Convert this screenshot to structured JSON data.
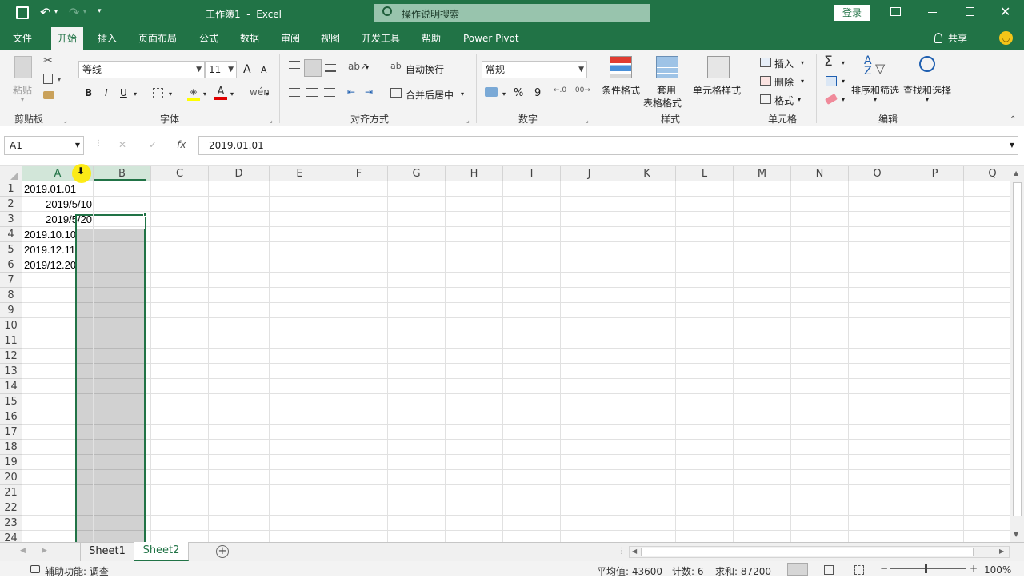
{
  "title": {
    "doc_title": "工作簿1  -  Excel",
    "search_placeholder": "操作说明搜索",
    "login": "登录"
  },
  "tabs": [
    "文件",
    "开始",
    "插入",
    "页面布局",
    "公式",
    "数据",
    "审阅",
    "视图",
    "开发工具",
    "帮助",
    "Power Pivot"
  ],
  "share": "共享",
  "ribbon": {
    "clipboard": {
      "paste": "粘贴",
      "label": "剪贴板"
    },
    "font": {
      "name": "等线",
      "size": "11",
      "bold": "B",
      "italic": "I",
      "underline": "U",
      "grow": "A",
      "shrink": "A",
      "label": "字体",
      "font_color_glyph": "A"
    },
    "align": {
      "wrap": "自动换行",
      "merge": "合并后居中",
      "label": "对齐方式"
    },
    "number": {
      "format": "常规",
      "percent": "%",
      "comma": "9",
      "label": "数字"
    },
    "styles": {
      "cond": "条件格式",
      "table_1": "套用",
      "table_2": "表格格式",
      "cell": "单元格样式",
      "label": "样式"
    },
    "cells": {
      "insert": "插入",
      "delete": "删除",
      "format": "格式",
      "label": "单元格"
    },
    "edit": {
      "sort": "排序和筛选",
      "find": "查找和选择",
      "label": "编辑"
    }
  },
  "formula_bar": {
    "name_box": "A1",
    "fx": "fx",
    "value": "2019.01.01"
  },
  "columns": [
    "A",
    "B",
    "C",
    "D",
    "E",
    "F",
    "G",
    "H",
    "I",
    "J",
    "K",
    "L",
    "M",
    "N",
    "O",
    "P",
    "Q"
  ],
  "rows": [
    "1",
    "2",
    "3",
    "4",
    "5",
    "6",
    "7",
    "8",
    "9",
    "10",
    "11",
    "12",
    "13",
    "14",
    "15",
    "16",
    "17",
    "18",
    "19",
    "20",
    "21",
    "22",
    "23",
    "24"
  ],
  "cells": [
    {
      "row": 1,
      "text": "2019.01.01",
      "align": "left"
    },
    {
      "row": 2,
      "text": "2019/5/10",
      "align": "right"
    },
    {
      "row": 3,
      "text": "2019/5/20",
      "align": "right"
    },
    {
      "row": 4,
      "text": "2019.10.10",
      "align": "left"
    },
    {
      "row": 5,
      "text": "2019.12.11",
      "align": "left"
    },
    {
      "row": 6,
      "text": "2019/12.20",
      "align": "left"
    }
  ],
  "sheets": [
    "Sheet1",
    "Sheet2"
  ],
  "active_sheet": "Sheet2",
  "status": {
    "accessibility": "辅助功能: 调查",
    "average": "平均值: 43600",
    "count": "计数: 6",
    "sum": "求和: 87200",
    "zoom": "100%"
  },
  "colors": {
    "brand": "#217346",
    "selection": "#217346",
    "cursor": "#ffea00"
  }
}
